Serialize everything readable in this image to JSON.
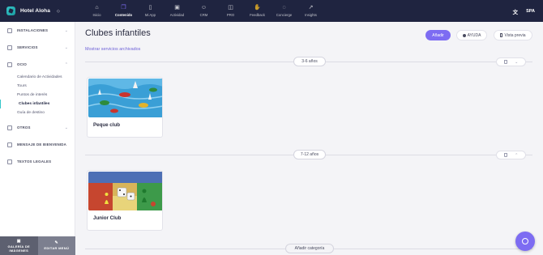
{
  "topbar": {
    "hotel_name": "Hotel Aloha",
    "nav": [
      {
        "label": "Inicio",
        "icon": "home-icon",
        "glyph": "⌂"
      },
      {
        "label": "Contenido",
        "icon": "content-icon",
        "glyph": "❒"
      },
      {
        "label": "Mi App",
        "icon": "phone-icon",
        "glyph": "▯"
      },
      {
        "label": "Actividad",
        "icon": "activity-icon",
        "glyph": "▣"
      },
      {
        "label": "CRM",
        "icon": "people-icon",
        "glyph": "☺"
      },
      {
        "label": "PRO",
        "icon": "bag-icon",
        "glyph": "◫"
      },
      {
        "label": "Feedback",
        "icon": "thumb-icon",
        "glyph": "✋"
      },
      {
        "label": "Concierge",
        "icon": "chat-icon",
        "glyph": "◌"
      },
      {
        "label": "Insights",
        "icon": "chart-icon",
        "glyph": "↗"
      }
    ],
    "language": "SPA"
  },
  "sidebar": {
    "sections": [
      {
        "label": "INSTALACIONES"
      },
      {
        "label": "SERVICIOS"
      },
      {
        "label": "OCIO"
      },
      {
        "label": "OTROS"
      },
      {
        "label": "MENSAJE DE BIENVENIDA"
      },
      {
        "label": "TEXTOS LEGALES"
      }
    ],
    "ocio_items": [
      "Calendario de Actividades",
      "Tours",
      "Puntos de interés",
      "Clubes infantiles",
      "Guía de destino"
    ],
    "bottom": {
      "gallery": "GALERÍA DE IMÁGENES",
      "edit_menu": "EDITAR MENÚ"
    }
  },
  "main": {
    "title": "Clubes infantiles",
    "archived_link": "Mostrar servicios archivados",
    "add_button": "Añadir",
    "help_button": "AYUDA",
    "preview_button": "Vista previa",
    "categories": [
      {
        "label": "3-6 años",
        "card_title": "Peque club"
      },
      {
        "label": "7-12 años",
        "card_title": "Junior Club"
      }
    ],
    "add_category": "Añadir categoría"
  },
  "colors": {
    "topbar": "#1f2440",
    "accent": "#7d6cf2",
    "teal": "#35c6c9"
  }
}
